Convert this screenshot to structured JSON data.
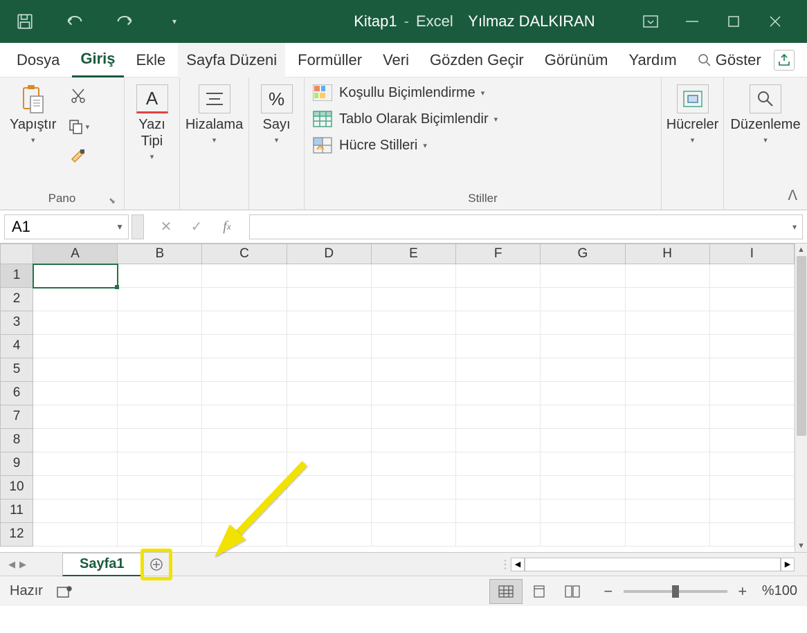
{
  "title": {
    "doc": "Kitap1",
    "sep": "-",
    "app": "Excel",
    "user": "Yılmaz DALKIRAN"
  },
  "tabs": {
    "file": "Dosya",
    "home": "Giriş",
    "insert": "Ekle",
    "pagelayout": "Sayfa Düzeni",
    "formulas": "Formüller",
    "data": "Veri",
    "review": "Gözden Geçir",
    "view": "Görünüm",
    "help": "Yardım",
    "tellme": "Göster"
  },
  "ribbon": {
    "clipboard": {
      "paste": "Yapıştır",
      "group": "Pano"
    },
    "font": {
      "label": "Yazı Tipi"
    },
    "align": {
      "label": "Hizalama"
    },
    "number": {
      "label": "Sayı"
    },
    "styles": {
      "conditional": "Koşullu Biçimlendirme",
      "table": "Tablo Olarak Biçimlendir",
      "cellstyles": "Hücre Stilleri",
      "group": "Stiller"
    },
    "cells": {
      "label": "Hücreler"
    },
    "editing": {
      "label": "Düzenleme"
    }
  },
  "namebox": "A1",
  "columns": [
    "A",
    "B",
    "C",
    "D",
    "E",
    "F",
    "G",
    "H",
    "I"
  ],
  "rows": [
    "1",
    "2",
    "3",
    "4",
    "5",
    "6",
    "7",
    "8",
    "9",
    "10",
    "11",
    "12"
  ],
  "sheets": {
    "active": "Sayfa1"
  },
  "status": {
    "ready": "Hazır",
    "zoom": "%100"
  }
}
